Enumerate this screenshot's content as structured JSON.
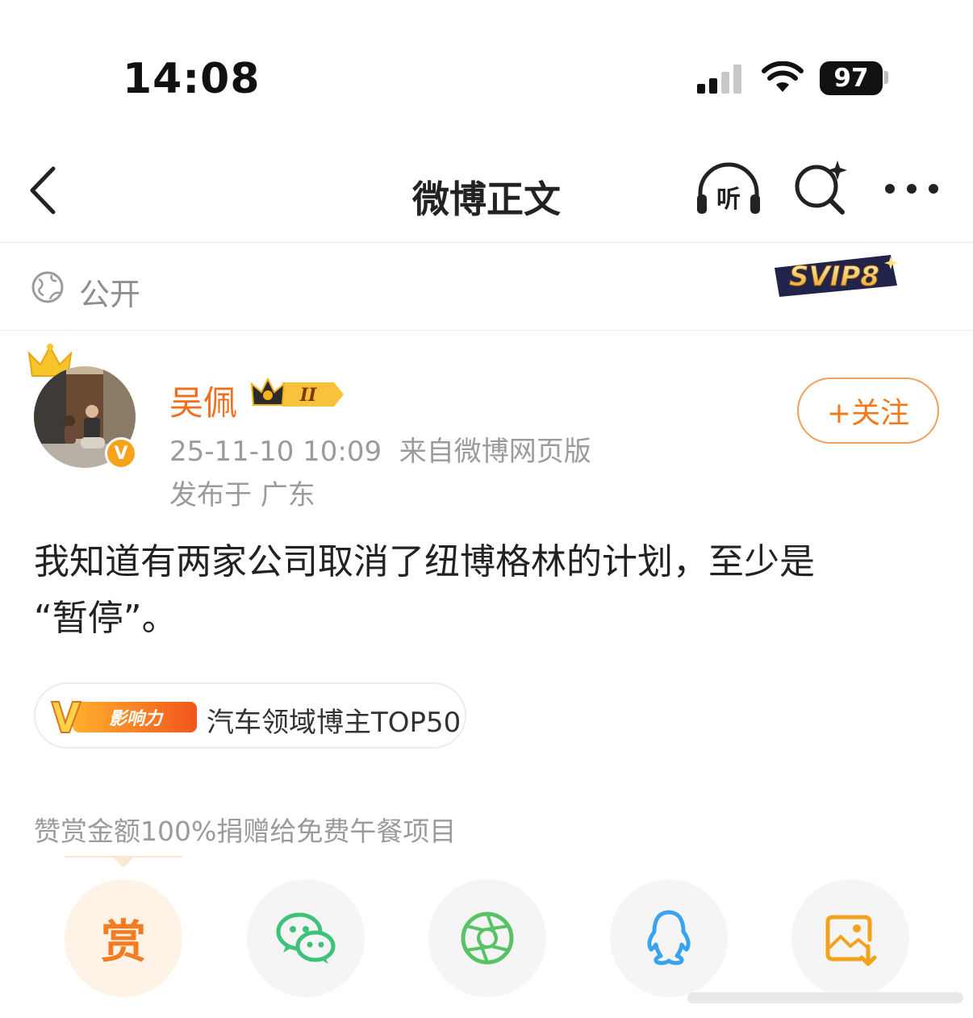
{
  "status_bar": {
    "time": "14:08",
    "battery": "97"
  },
  "nav": {
    "title": "微博正文"
  },
  "visibility": {
    "label": "公开",
    "svip_badge": "SVIP8"
  },
  "author": {
    "name": "吴佩",
    "level_badge": "II",
    "verified_mark": "V",
    "timestamp": "25-11-10 10:09",
    "source": "来自微博网页版",
    "location": "发布于 广东",
    "follow_label": "+关注"
  },
  "post": {
    "line1": "我知道有两家公司取消了纽博格林的计划，至少是",
    "line2": "“暂停”。"
  },
  "influence": {
    "badge_label": "影响力",
    "text": "汽车领域博主TOP50"
  },
  "reward_note": "赞赏金额100%捐赠给免费午餐项目",
  "share": {
    "reward_label": "赏"
  },
  "colors": {
    "accent": "#f26e1a",
    "wechat": "#3ec27a",
    "moments": "#59c264",
    "qq": "#3aa3f0",
    "save": "#f4a21c"
  }
}
